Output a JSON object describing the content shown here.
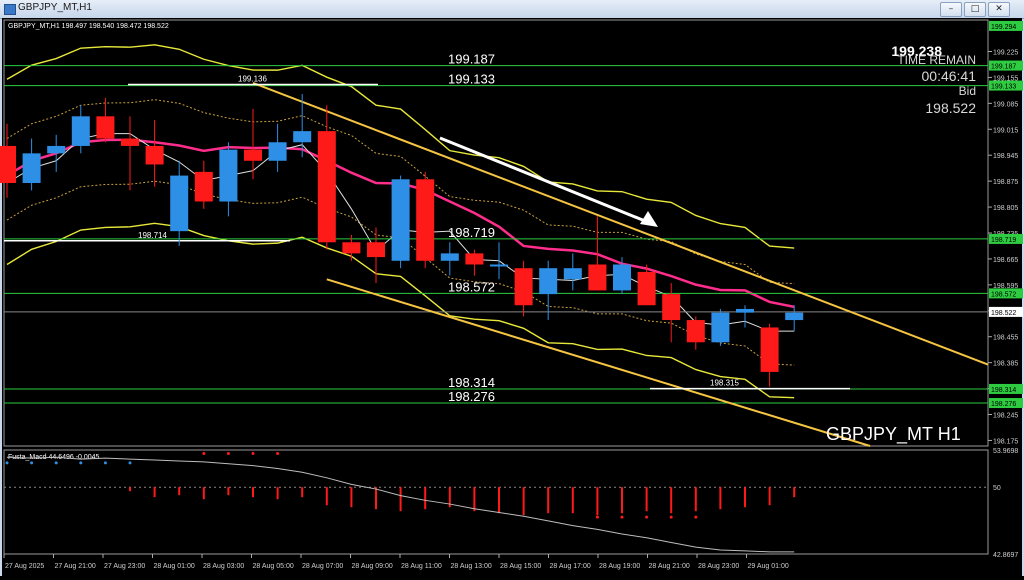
{
  "window": {
    "title": "GBPJPY_MT,H1",
    "btn_min": "–",
    "btn_max": "□",
    "btn_close": "✕"
  },
  "chart_data": {
    "type": "candlestick",
    "symbol_label": "GBPJPY_MT H1",
    "ohlc_header": "GBPJPY_MT,H1  198.497 198.540 198.472 198.522",
    "time_remain": {
      "price": "199.238",
      "label": "TIME REMAIN",
      "value": "00:46:41",
      "bid_label": "Bid",
      "bid_value": "198.522"
    },
    "price_range": [
      198.16,
      199.31
    ],
    "y_ticks": [
      "199.225",
      "199.155",
      "199.085",
      "199.015",
      "198.945",
      "198.875",
      "198.805",
      "198.735",
      "198.665",
      "198.595",
      "198.525",
      "198.455",
      "198.385",
      "198.315",
      "198.245",
      "198.175"
    ],
    "x_labels": [
      "27 Aug 2025",
      "27 Aug 21:00",
      "27 Aug 23:00",
      "28 Aug 01:00",
      "28 Aug 03:00",
      "28 Aug 05:00",
      "28 Aug 07:00",
      "28 Aug 09:00",
      "28 Aug 11:00",
      "28 Aug 13:00",
      "28 Aug 15:00",
      "28 Aug 17:00",
      "28 Aug 19:00",
      "28 Aug 21:00",
      "28 Aug 23:00",
      "29 Aug 01:00"
    ],
    "candles": [
      {
        "o": 198.97,
        "h": 199.03,
        "l": 198.83,
        "c": 198.87
      },
      {
        "o": 198.87,
        "h": 198.99,
        "l": 198.85,
        "c": 198.95
      },
      {
        "o": 198.95,
        "h": 199.0,
        "l": 198.9,
        "c": 198.97
      },
      {
        "o": 198.97,
        "h": 199.08,
        "l": 198.95,
        "c": 199.05
      },
      {
        "o": 199.05,
        "h": 199.1,
        "l": 198.98,
        "c": 198.99
      },
      {
        "o": 198.99,
        "h": 199.05,
        "l": 198.85,
        "c": 198.97
      },
      {
        "o": 198.97,
        "h": 199.04,
        "l": 198.86,
        "c": 198.92
      },
      {
        "o": 198.74,
        "h": 198.93,
        "l": 198.7,
        "c": 198.89
      },
      {
        "o": 198.9,
        "h": 198.93,
        "l": 198.8,
        "c": 198.82
      },
      {
        "o": 198.82,
        "h": 198.98,
        "l": 198.78,
        "c": 198.96
      },
      {
        "o": 198.96,
        "h": 199.07,
        "l": 198.88,
        "c": 198.93
      },
      {
        "o": 198.93,
        "h": 199.03,
        "l": 198.9,
        "c": 198.98
      },
      {
        "o": 198.98,
        "h": 199.11,
        "l": 198.94,
        "c": 199.01
      },
      {
        "o": 199.01,
        "h": 199.08,
        "l": 198.69,
        "c": 198.71
      },
      {
        "o": 198.71,
        "h": 198.73,
        "l": 198.66,
        "c": 198.68
      },
      {
        "o": 198.71,
        "h": 198.75,
        "l": 198.6,
        "c": 198.67
      },
      {
        "o": 198.66,
        "h": 198.89,
        "l": 198.64,
        "c": 198.88
      },
      {
        "o": 198.88,
        "h": 198.9,
        "l": 198.64,
        "c": 198.66
      },
      {
        "o": 198.66,
        "h": 198.71,
        "l": 198.62,
        "c": 198.68
      },
      {
        "o": 198.68,
        "h": 198.69,
        "l": 198.62,
        "c": 198.65
      },
      {
        "o": 198.65,
        "h": 198.71,
        "l": 198.61,
        "c": 198.65
      },
      {
        "o": 198.64,
        "h": 198.66,
        "l": 198.51,
        "c": 198.54
      },
      {
        "o": 198.57,
        "h": 198.66,
        "l": 198.5,
        "c": 198.64
      },
      {
        "o": 198.61,
        "h": 198.68,
        "l": 198.58,
        "c": 198.64
      },
      {
        "o": 198.65,
        "h": 198.78,
        "l": 198.58,
        "c": 198.58
      },
      {
        "o": 198.58,
        "h": 198.67,
        "l": 198.57,
        "c": 198.65
      },
      {
        "o": 198.63,
        "h": 198.65,
        "l": 198.54,
        "c": 198.54
      },
      {
        "o": 198.57,
        "h": 198.6,
        "l": 198.44,
        "c": 198.5
      },
      {
        "o": 198.5,
        "h": 198.51,
        "l": 198.42,
        "c": 198.44
      },
      {
        "o": 198.44,
        "h": 198.53,
        "l": 198.43,
        "c": 198.52
      },
      {
        "o": 198.52,
        "h": 198.54,
        "l": 198.48,
        "c": 198.53
      },
      {
        "o": 198.48,
        "h": 198.49,
        "l": 198.32,
        "c": 198.36
      },
      {
        "o": 198.5,
        "h": 198.54,
        "l": 198.47,
        "c": 198.52
      }
    ],
    "horizontal_levels": [
      {
        "price": 199.187,
        "label": "199.187",
        "color": "#2ecc40"
      },
      {
        "price": 199.133,
        "label": "199.133",
        "color": "#2ecc40"
      },
      {
        "price": 198.719,
        "label": "198.719",
        "color": "#2ecc40"
      },
      {
        "price": 198.572,
        "label": "198.572",
        "color": "#2ecc40"
      },
      {
        "price": 198.314,
        "label": "198.314",
        "color": "#2ecc40"
      },
      {
        "price": 198.276,
        "label": "198.276",
        "color": "#2ecc40"
      }
    ],
    "level_axis_tags": [
      "199.294",
      "199.187",
      "199.133",
      "198.719",
      "198.572",
      "198.314",
      "198.276"
    ],
    "current_bid_tag": "198.522",
    "point_labels": [
      "199.136",
      "198.714",
      "198.315"
    ],
    "indicator": {
      "label": "Fusta_Macd 44.6496 -0.0045",
      "y_ticks": [
        "53.9698",
        "50",
        "42.8697"
      ],
      "range": [
        42.8697,
        53.9698
      ]
    },
    "colors": {
      "bull": "#2e8fe6",
      "bear": "#ff1a1a",
      "level": "#2ecc40",
      "channel": "#f5c542",
      "band": "#e8e83a",
      "ma": "#ff2d8c",
      "grid": "#333"
    }
  }
}
